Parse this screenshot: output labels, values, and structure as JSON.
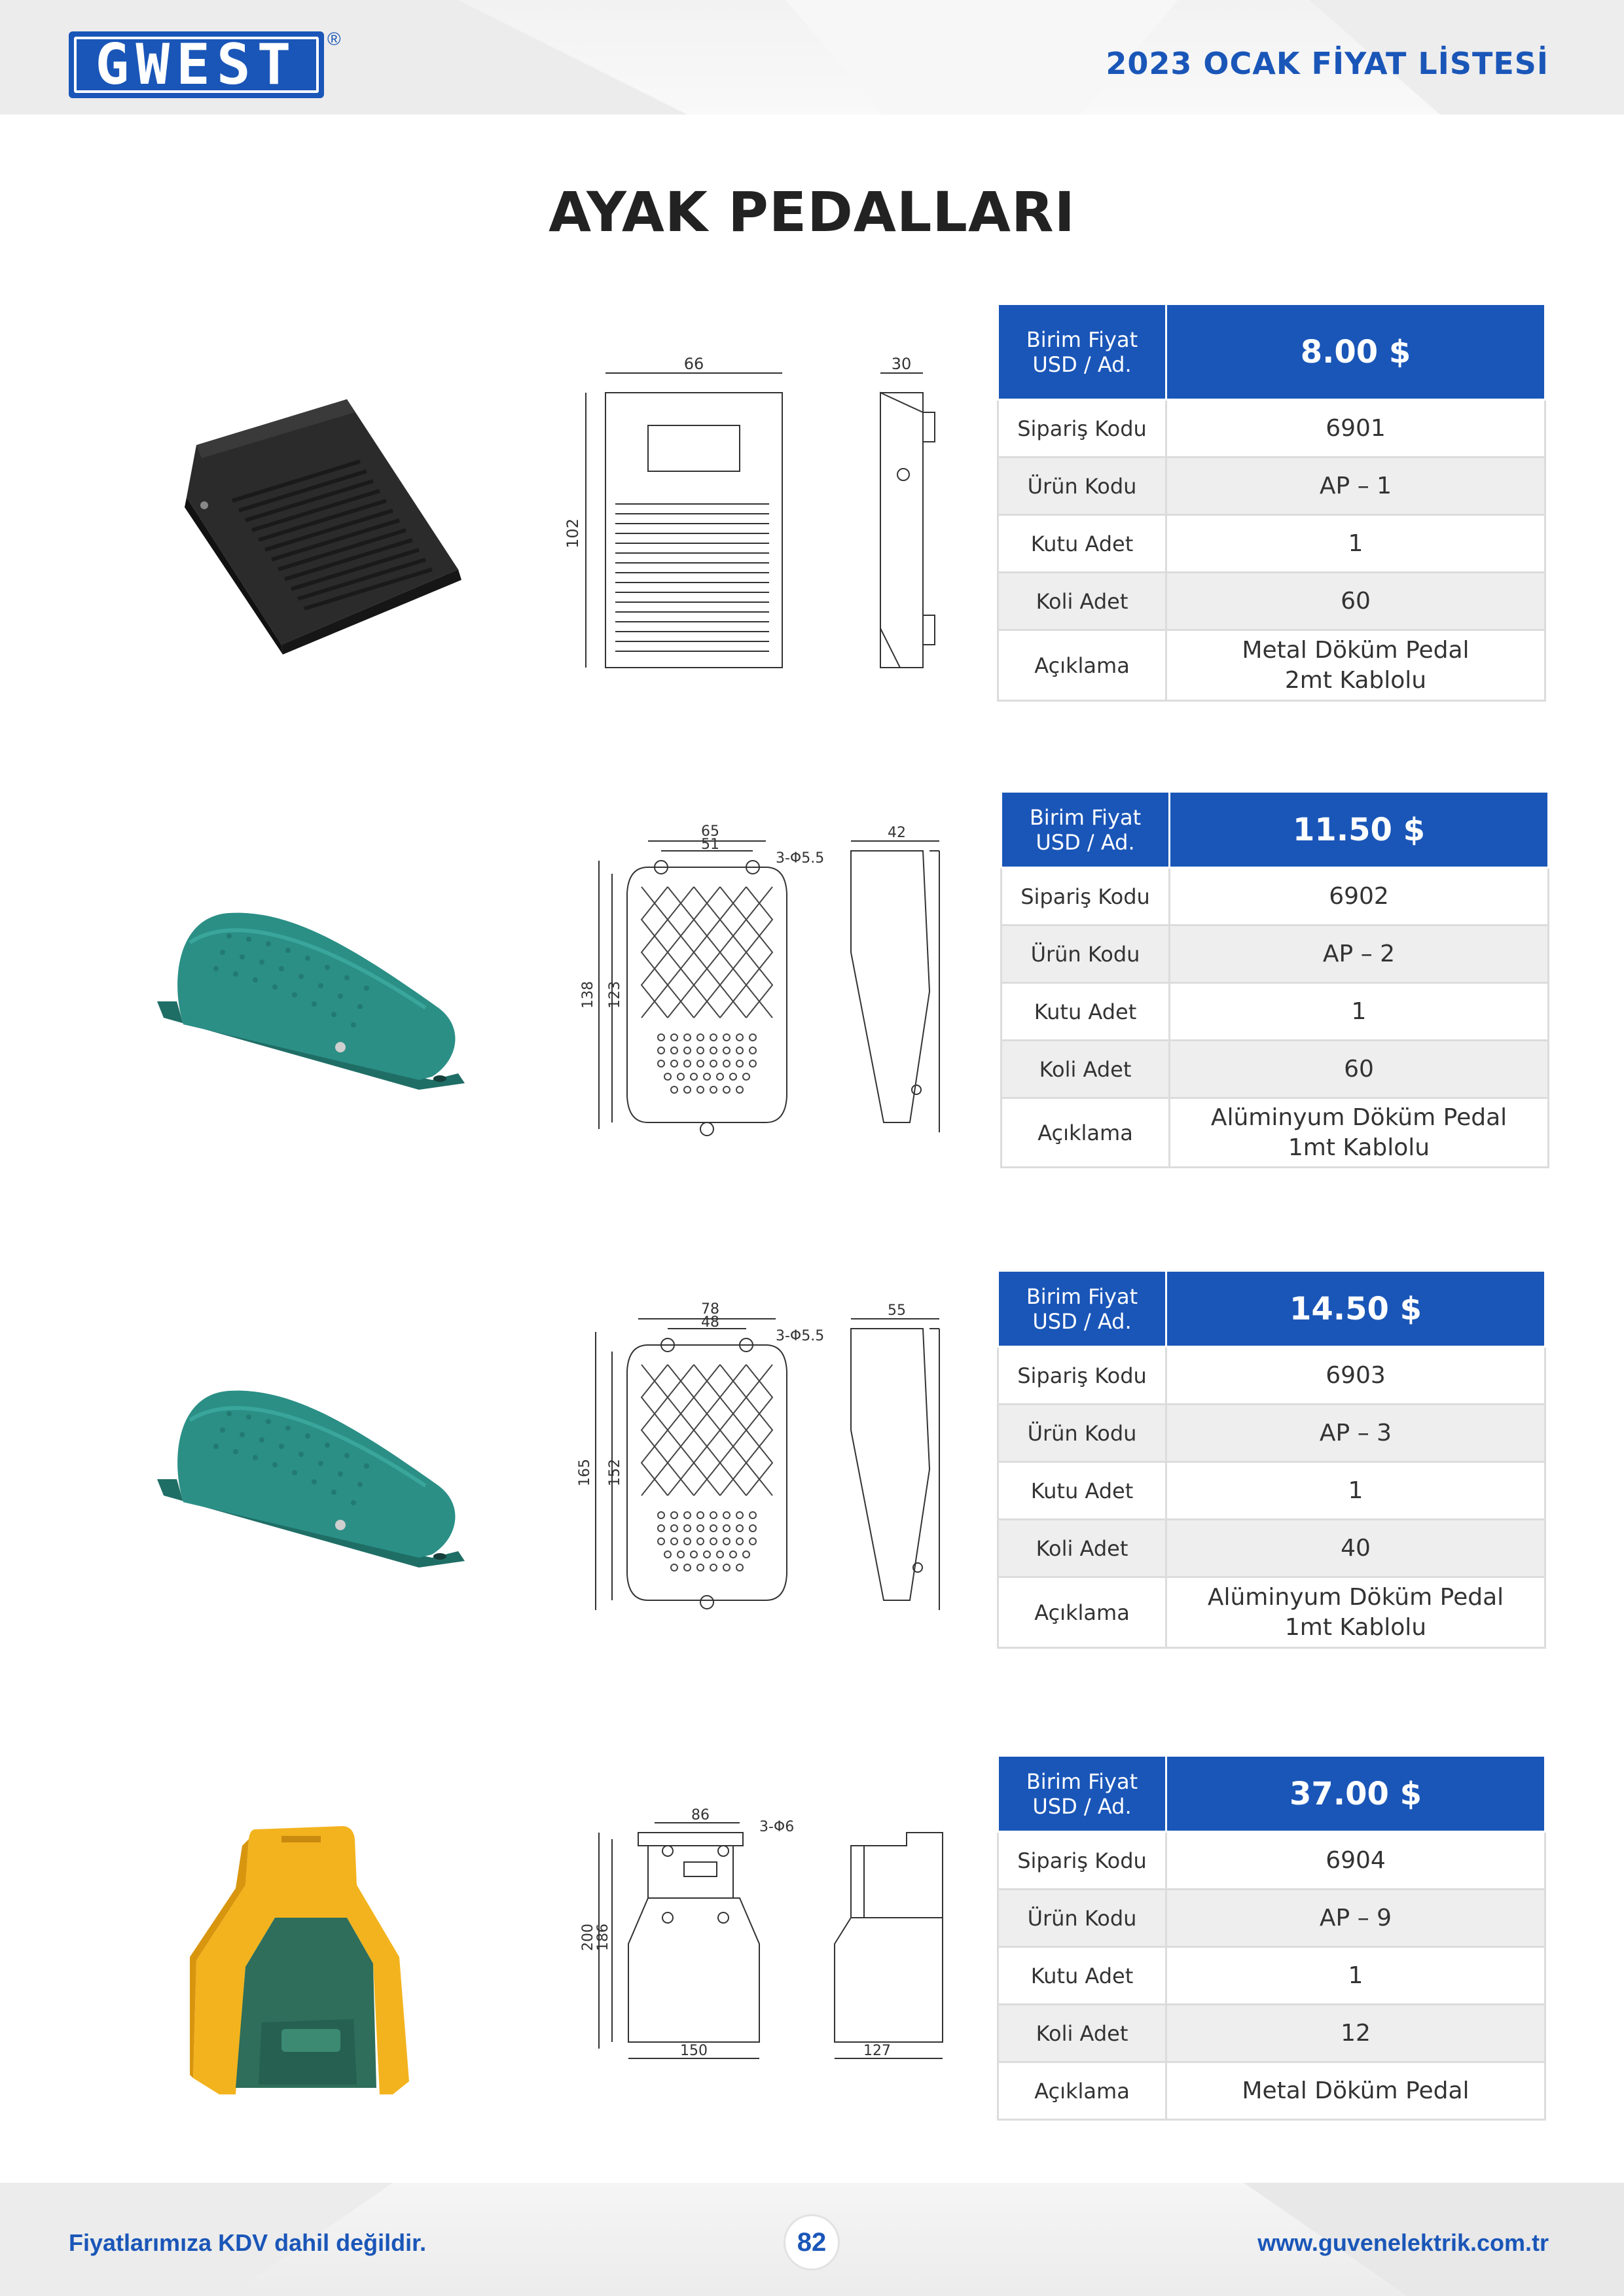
{
  "header": {
    "logo_text": "GWEST",
    "registered_mark": "®",
    "title": "2023 OCAK FİYAT LİSTESİ"
  },
  "page_title": "AYAK PEDALLARI",
  "labels": {
    "price_head_line1": "Birim Fiyat",
    "price_head_line2": "USD / Ad.",
    "order_code": "Sipariş Kodu",
    "product_code": "Ürün Kodu",
    "box_qty": "Kutu Adet",
    "parcel_qty": "Koli Adet",
    "description": "Açıklama"
  },
  "products": [
    {
      "price": "8.00 $",
      "order_code": "6901",
      "product_code": "AP – 1",
      "box_qty": "1",
      "parcel_qty": "60",
      "description_line1": "Metal Döküm Pedal",
      "description_line2": "2mt Kablolu",
      "color": "#2a2a2a",
      "dims": {
        "width": "66",
        "height": "102",
        "depth": "30"
      }
    },
    {
      "price": "11.50 $",
      "order_code": "6902",
      "product_code": "AP – 2",
      "box_qty": "1",
      "parcel_qty": "60",
      "description_line1": "Alüminyum Döküm Pedal",
      "description_line2": "1mt Kablolu",
      "color": "#2b8f86",
      "dims": {
        "width": "65",
        "inner": "51",
        "hole": "3-Φ5.5",
        "height": "138",
        "inner_h": "123",
        "depth": "42"
      }
    },
    {
      "price": "14.50 $",
      "order_code": "6903",
      "product_code": "AP – 3",
      "box_qty": "1",
      "parcel_qty": "40",
      "description_line1": "Alüminyum Döküm Pedal",
      "description_line2": "1mt Kablolu",
      "color": "#2b8f86",
      "dims": {
        "width": "78",
        "inner": "48",
        "hole": "3-Φ5.5",
        "height": "165",
        "inner_h": "152",
        "depth": "55"
      }
    },
    {
      "price": "37.00 $",
      "order_code": "6904",
      "product_code": "AP – 9",
      "box_qty": "1",
      "parcel_qty": "12",
      "description_line1": "Metal Döküm Pedal",
      "description_line2": "",
      "color": "#f3b31e",
      "dims": {
        "width": "86",
        "hole": "3-Φ6",
        "height": "200",
        "inner_h": "186",
        "bottom": "150",
        "depth": "127"
      }
    }
  ],
  "footer": {
    "left": "Fiyatlarımıza KDV dahil değildir.",
    "page": "82",
    "right": "www.guvenelektrik.com.tr"
  },
  "colors": {
    "brand": "#1a56b8",
    "row_alt": "#eeeeee",
    "border": "#dcdcdc"
  }
}
